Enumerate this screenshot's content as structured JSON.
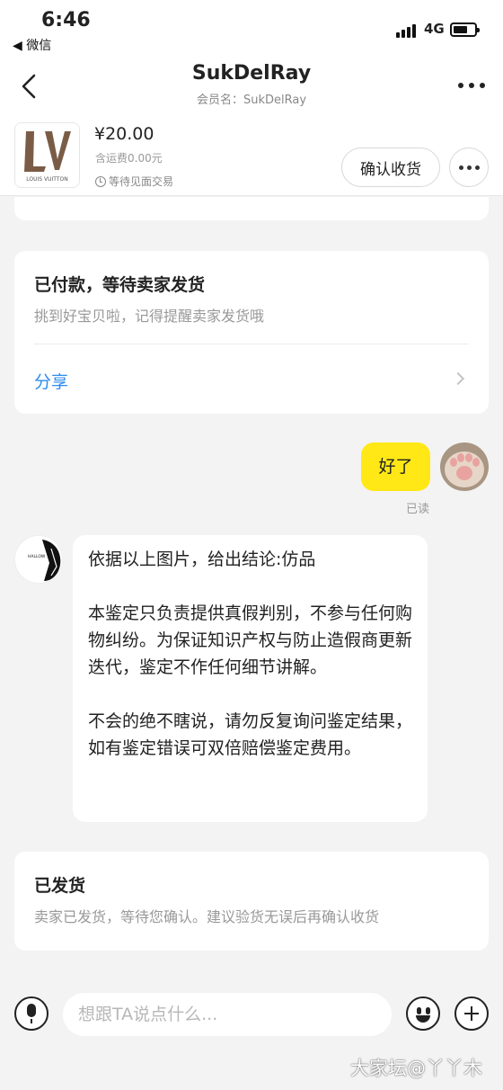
{
  "status_bar": {
    "time": "6:46",
    "back_app": "◀ 微信",
    "network": "4G"
  },
  "nav": {
    "title": "SukDelRay",
    "subtitle": "会员名：SukDelRay"
  },
  "product": {
    "brand_lettering": "LOUIS VUITTON",
    "price": "¥20.00",
    "shipping_fee": "含运费0.00元",
    "trade_mode": "等待见面交易",
    "confirm_label": "确认收货"
  },
  "order_status_card": {
    "title": "已付款，等待卖家发货",
    "desc": "挑到好宝贝啦，记得提醒卖家发货哦",
    "share_label": "分享"
  },
  "messages": {
    "mine": {
      "text": "好了",
      "read_status": "已读"
    },
    "other": {
      "avatar_lettering": "HALLOW",
      "paragraphs": [
        "依据以上图片，给出结论:仿品",
        "本鉴定只负责提供真假判别，不参与任何购物纠纷。为保证知识产权与防止造假商更新迭代，鉴定不作任何细节讲解。",
        "不会的绝不瞎说，请勿反复询问鉴定结果，如有鉴定错误可双倍赔偿鉴定费用。"
      ]
    }
  },
  "shipped_card": {
    "title": "已发货",
    "desc": "卖家已发货，等待您确认。建议验货无误后再确认收货"
  },
  "input_bar": {
    "value": "",
    "placeholder": "想跟TA说点什么..."
  },
  "watermark": "大家坛@丫丫木",
  "colors": {
    "accent_yellow": "#ffe815",
    "link_blue": "#2d8cf0",
    "background": "#f3f3f3"
  },
  "icons": [
    "back-chevron-icon",
    "more-dots-icon",
    "clock-icon",
    "chevron-right-icon",
    "microphone-icon",
    "emoji-icon",
    "plus-icon",
    "signal-icon",
    "battery-icon"
  ]
}
